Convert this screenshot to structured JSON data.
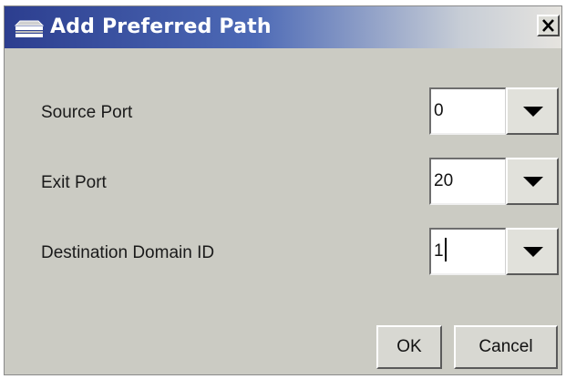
{
  "window": {
    "title": "Add Preferred Path",
    "title_icon": "window-menu-icon",
    "close_icon": "close-x-icon",
    "titlebar_color_start": "#2c3e8f",
    "dialog_background": "#cbcbc3"
  },
  "fields": [
    {
      "label": "Source Port",
      "value": "0",
      "dropdown_icon": "chevron-down-icon"
    },
    {
      "label": "Exit Port",
      "value": "20",
      "dropdown_icon": "chevron-down-icon"
    },
    {
      "label": "Destination Domain ID",
      "value": "1",
      "dropdown_icon": "chevron-down-icon",
      "focused": true
    }
  ],
  "buttons": {
    "ok": "OK",
    "cancel": "Cancel"
  }
}
